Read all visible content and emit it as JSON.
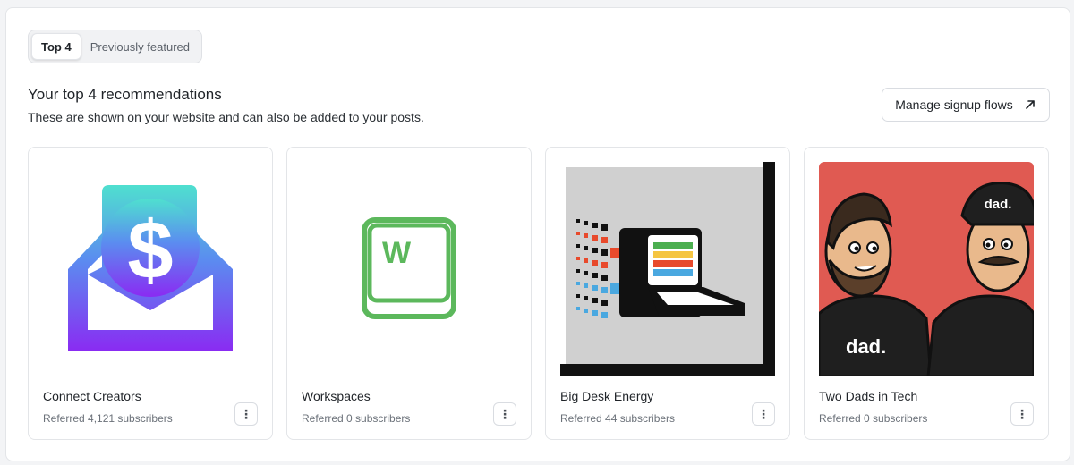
{
  "tabs": [
    {
      "label": "Top 4",
      "active": true
    },
    {
      "label": "Previously featured",
      "active": false
    }
  ],
  "heading": "Your top 4 recommendations",
  "subheading": "These are shown on your website and can also be added to your posts.",
  "manage_button": {
    "label": "Manage signup flows",
    "icon": "arrow-up-right-icon"
  },
  "cards": [
    {
      "name": "Connect Creators",
      "referred": "Referred 4,121 subscribers",
      "image": "connect-creators-logo",
      "menu_icon": "more-vertical-icon"
    },
    {
      "name": "Workspaces",
      "referred": "Referred 0 subscribers",
      "image": "workspaces-logo",
      "menu_icon": "more-vertical-icon"
    },
    {
      "name": "Big Desk Energy",
      "referred": "Referred 44 subscribers",
      "image": "big-desk-energy-logo",
      "menu_icon": "more-vertical-icon"
    },
    {
      "name": "Two Dads in Tech",
      "referred": "Referred 0 subscribers",
      "image": "two-dads-in-tech-logo",
      "logo_text": "dad.",
      "menu_icon": "more-vertical-icon"
    }
  ],
  "colors": {
    "accent_purple": "#8a3cf0",
    "accent_teal": "#4ed8d0",
    "workspaces_green": "#5cb85c",
    "dads_red": "#e05a52"
  }
}
